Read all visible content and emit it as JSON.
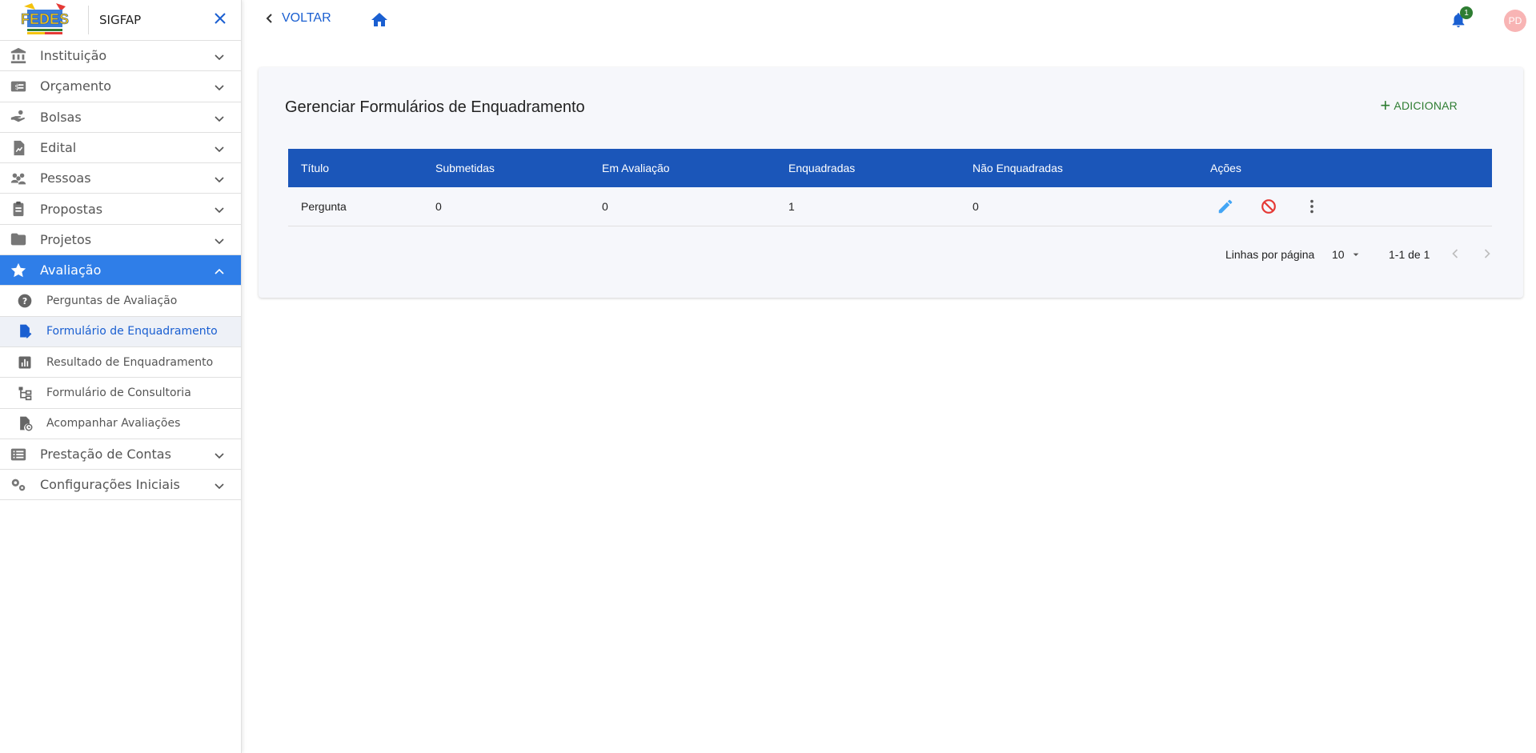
{
  "app": {
    "name": "SIGFAP",
    "logo_text": "FEDES"
  },
  "sidebar": {
    "items": [
      {
        "label": "Instituição",
        "icon": "bank-icon"
      },
      {
        "label": "Orçamento",
        "icon": "budget-icon"
      },
      {
        "label": "Bolsas",
        "icon": "hand-coin-icon"
      },
      {
        "label": "Edital",
        "icon": "document-chart-icon"
      },
      {
        "label": "Pessoas",
        "icon": "people-icon"
      },
      {
        "label": "Propostas",
        "icon": "clipboard-icon"
      },
      {
        "label": "Projetos",
        "icon": "folder-icon"
      },
      {
        "label": "Avaliação",
        "icon": "star-icon",
        "active": true
      }
    ],
    "sub_items": [
      {
        "label": "Perguntas de Avaliação",
        "icon": "question-icon"
      },
      {
        "label": "Formulário de Enquadramento",
        "icon": "file-edit-icon",
        "selected": true
      },
      {
        "label": "Resultado de Enquadramento",
        "icon": "bar-chart-icon"
      },
      {
        "label": "Formulário de Consultoria",
        "icon": "hierarchy-icon"
      },
      {
        "label": "Acompanhar Avaliações",
        "icon": "file-clock-icon"
      }
    ],
    "bottom_items": [
      {
        "label": "Prestação de Contas",
        "icon": "list-icon"
      },
      {
        "label": "Configurações Iniciais",
        "icon": "gears-icon"
      }
    ]
  },
  "topbar": {
    "back_label": "VOLTAR",
    "notification_count": "1",
    "avatar_initials": "PD"
  },
  "page": {
    "title": "Gerenciar Formulários de Enquadramento",
    "add_label": "ADICIONAR"
  },
  "table": {
    "columns": [
      "Título",
      "Submetidas",
      "Em Avaliação",
      "Enquadradas",
      "Não Enquadradas",
      "Ações"
    ],
    "rows": [
      {
        "titulo": "Pergunta",
        "submetidas": "0",
        "em_avaliacao": "0",
        "enquadradas": "1",
        "nao_enquadradas": "0"
      }
    ]
  },
  "pagination": {
    "rows_label": "Linhas por página",
    "rows_per_page": "10",
    "range": "1-1 de 1"
  },
  "colors": {
    "primary": "#1b56b9",
    "active_nav": "#2f7ee8",
    "add_green": "#2e7d32",
    "edit_blue": "#42a5f5",
    "block_red": "#e53935"
  }
}
